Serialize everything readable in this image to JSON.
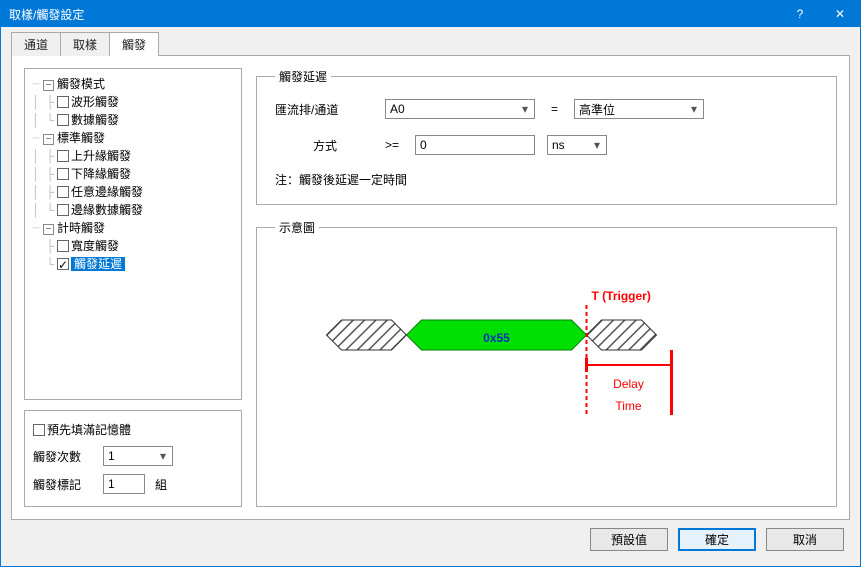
{
  "window": {
    "title": "取樣/觸發設定",
    "help": "?",
    "close": "✕"
  },
  "tabs": {
    "t0": "通道",
    "t1": "取樣",
    "t2": "觸發"
  },
  "tree": {
    "g0": "觸發模式",
    "g0_0": "波形觸發",
    "g0_1": "數據觸發",
    "g1": "標準觸發",
    "g1_0": "上升緣觸發",
    "g1_1": "下降緣觸發",
    "g1_2": "任意邊緣觸發",
    "g1_3": "邊緣數據觸發",
    "g2": "計時觸發",
    "g2_0": "寬度觸發",
    "g2_1": "觸發延遲"
  },
  "options": {
    "prefill": "預先填滿記憶體",
    "count_label": "觸發次數",
    "count_value": "1",
    "mark_label": "觸發標記",
    "mark_value": "1",
    "mark_unit": "組"
  },
  "panel": {
    "group_title": "觸發延遲",
    "bus_label": "匯流排/通道",
    "bus_value": "A0",
    "eq": "=",
    "level_value": "高準位",
    "mode_label": "方式",
    "mode_op": ">=",
    "mode_value": "0",
    "mode_unit": "ns",
    "note": "注：觸發後延遲一定時間"
  },
  "diagram": {
    "title": "示意圖",
    "t_label": "T (Trigger)",
    "hex": "0x55",
    "delay": "Delay",
    "time": "Time"
  },
  "footer": {
    "defaults": "預設值",
    "ok": "確定",
    "cancel": "取消"
  }
}
